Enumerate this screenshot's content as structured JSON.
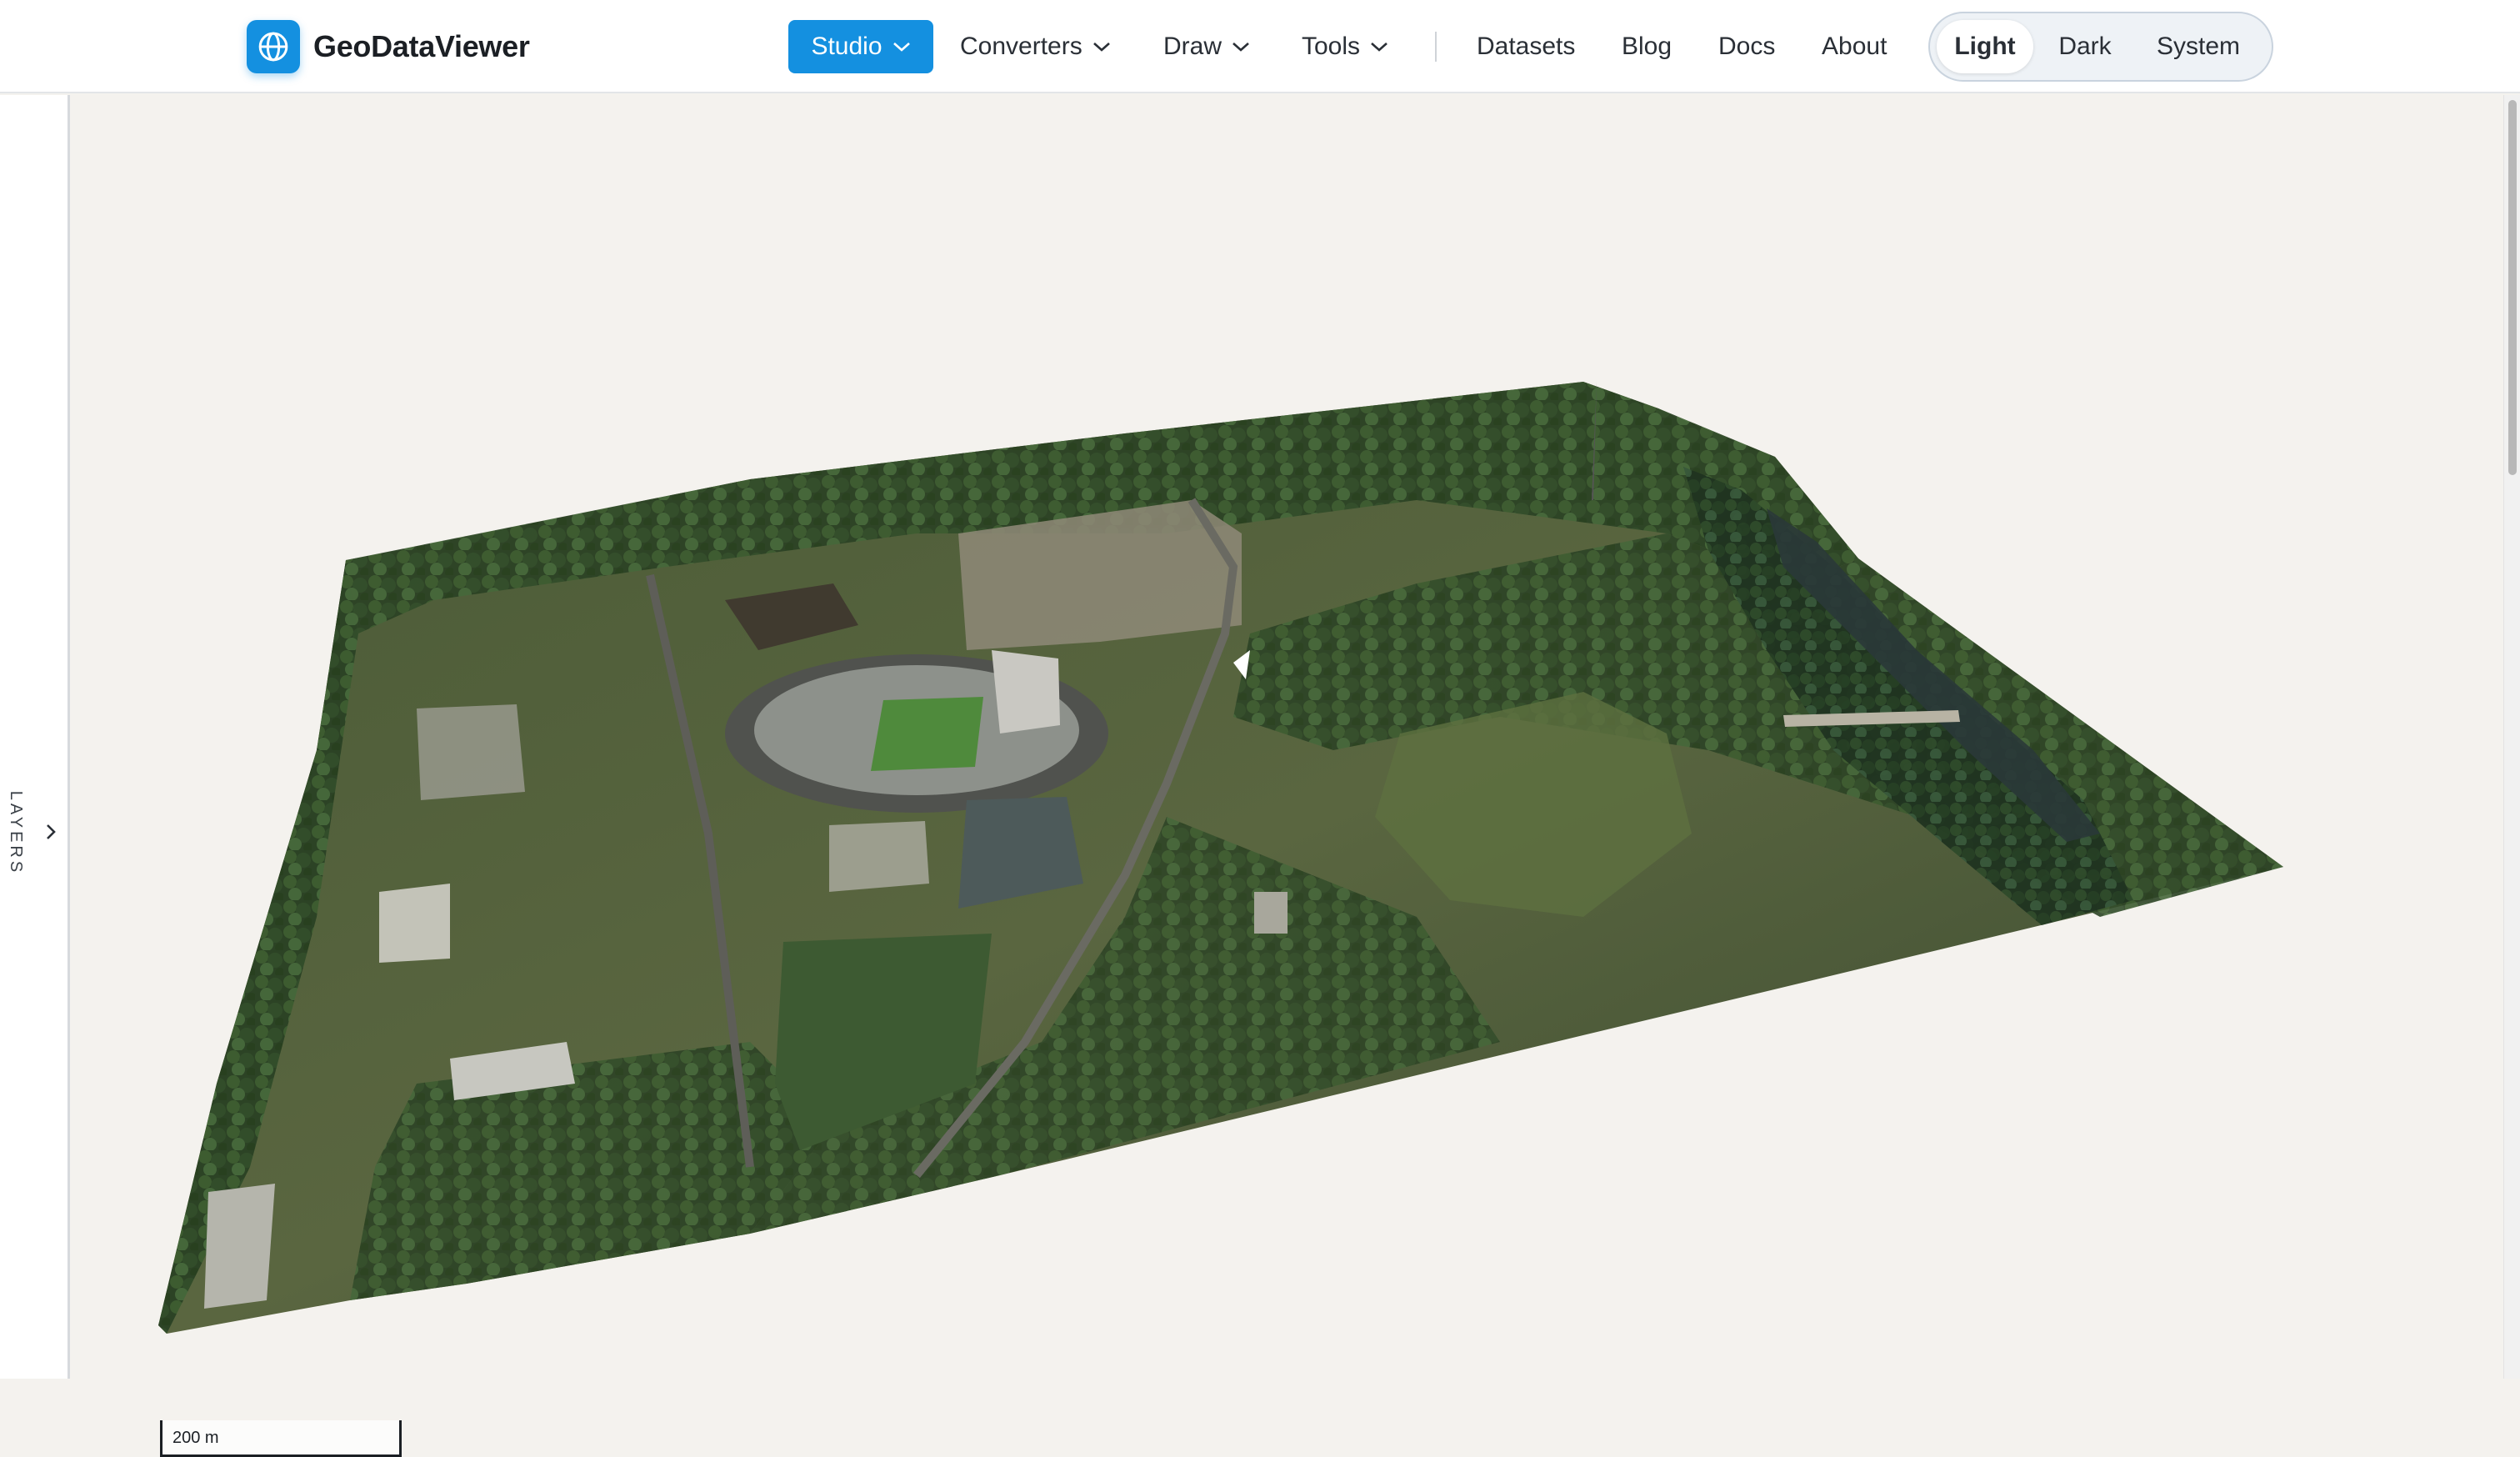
{
  "app": {
    "name": "GeoDataViewer",
    "logo_icon": "globe-icon",
    "accent": "#1490e0"
  },
  "nav": {
    "studio": "Studio",
    "converters": "Converters",
    "draw": "Draw",
    "tools": "Tools",
    "datasets": "Datasets",
    "blog": "Blog",
    "docs": "Docs",
    "about": "About"
  },
  "theme": {
    "options": [
      "Light",
      "Dark",
      "System"
    ],
    "selected": "Light"
  },
  "sidebar": {
    "label": "LAYERS",
    "toggle_icon": "chevron-right-icon"
  },
  "map": {
    "view": "3D oblique aerial imagery of a stadium campus with parkland and river",
    "scale_label": "200 m",
    "controls": [
      "basemap-icon",
      "zoom-in-icon",
      "zoom-out-icon",
      "compass-icon",
      "fullscreen-icon",
      "globe-icon",
      "locate-icon",
      "terrain-icon",
      "settings-icon",
      "info-icon"
    ]
  }
}
